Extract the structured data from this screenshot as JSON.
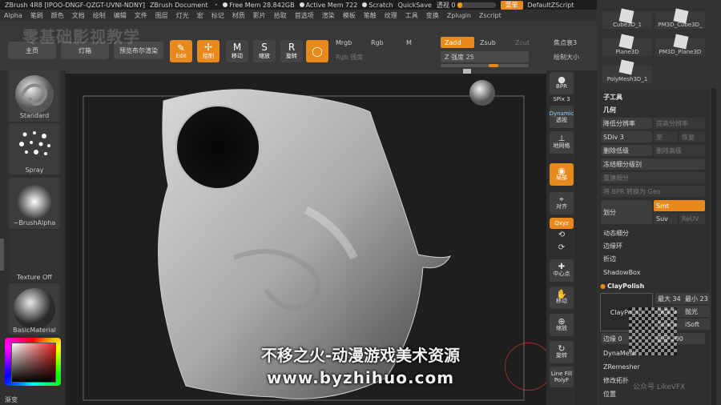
{
  "titlebar": {
    "app": "ZBrush 4R8 [IPOO-DNGF-QZGT-UVNI-NDNY]",
    "document": "ZBrush Document",
    "free_mem": "Free Mem 28.842GB",
    "active_mem": "Active Mem 722",
    "scratch": "Scratch",
    "quicksave": "QuickSave",
    "transparency_label": "透视 0",
    "menu_label": "菜单",
    "zscript": "DefaultZScript"
  },
  "menu": [
    "Alpha",
    "笔刷",
    "颜色",
    "文档",
    "绘制",
    "编辑",
    "文件",
    "图层",
    "灯光",
    "宏",
    "标记",
    "材质",
    "影片",
    "拾取",
    "首选项",
    "渲染",
    "模板",
    "笔触",
    "纹理",
    "工具",
    "变换",
    "Zplugin",
    "Zscript"
  ],
  "shelf": {
    "home": "主页",
    "lightbox": "灯箱",
    "bpr": "预览布尔渲染",
    "edit": "Edit",
    "draw": "绘制",
    "move": "移动",
    "scale": "缩放",
    "rotate": "旋转",
    "mrgb": "Mrgb",
    "rgb": "Rgb",
    "m": "M",
    "zadd": "Zadd",
    "zsub": "Zsub",
    "zcut": "Zcut",
    "rgb_intensity": "Rgb 强度",
    "z_intensity": "Z 强度 25",
    "focal_shift": "焦点衰3",
    "draw_size": "绘制大小"
  },
  "watermark_top": "零基础影视教学",
  "leftpanel": {
    "standard": "Standard",
    "spray": "Spray",
    "brush_alpha": "~BrushAlpha",
    "texture_off": "Texture Off",
    "material": "BasicMaterial",
    "gradient": "渐变"
  },
  "righttools": {
    "bpr": "BPR",
    "spix": "SPix 3",
    "dynamic": "Dynamic",
    "perspective": "透视",
    "floor": "地网格",
    "solo": "局部",
    "frame": "对齐",
    "xyz": "Qxyz",
    "center": "中心点",
    "move": "移动",
    "scale": "缩放",
    "rotate": "旋转",
    "linefill": "Line Fill",
    "polyf": "PolyF"
  },
  "rightpanel": {
    "subtools": [
      "Cube3D_1",
      "PM3D_Cube3D_",
      "Plane3D",
      "PM3D_Plane3D",
      "PolyMesh3D_1"
    ],
    "subtool_header": "子工具",
    "geometry_header": "几何",
    "lower_res": "降低分辨率",
    "higher_res": "提高分辨率",
    "sdiv": "SDiv 3",
    "cage": "笼",
    "rstr": "恢复",
    "del_lower": "删除低级",
    "del_higher": "删除高级",
    "freeze_subdiv": "冻结细分级别",
    "reconstruct": "重建细分",
    "convert_bpr": "将 BPR 转换为 Geo",
    "divide": "划分",
    "smt": "Smt",
    "suv": "Suv",
    "reuv": "ReUV",
    "dynamic_subdiv": "动态细分",
    "edge_loop": "边缘环",
    "crease": "折边",
    "shadowbox": "ShadowBox",
    "claypolish": "ClayPolish",
    "claypolish_btn": "ClayPolish",
    "max": "最大 34",
    "min": "最小 23",
    "sharp_pref": "锐度 0",
    "polish": "抛光",
    "sharp": "Sharp",
    "isoft": "iSoft",
    "edge": "边缘 0",
    "surface": "曲面 100",
    "dynamesh": "DynaMesh",
    "zremesher": "ZRemesher",
    "modify_topo": "修改拓扑",
    "position": "位置"
  },
  "overlay": {
    "line1": "不移之火-动漫游戏美术资源",
    "line2": "www.byzhihuo.com",
    "brand": "公众号 LikeVFX"
  }
}
